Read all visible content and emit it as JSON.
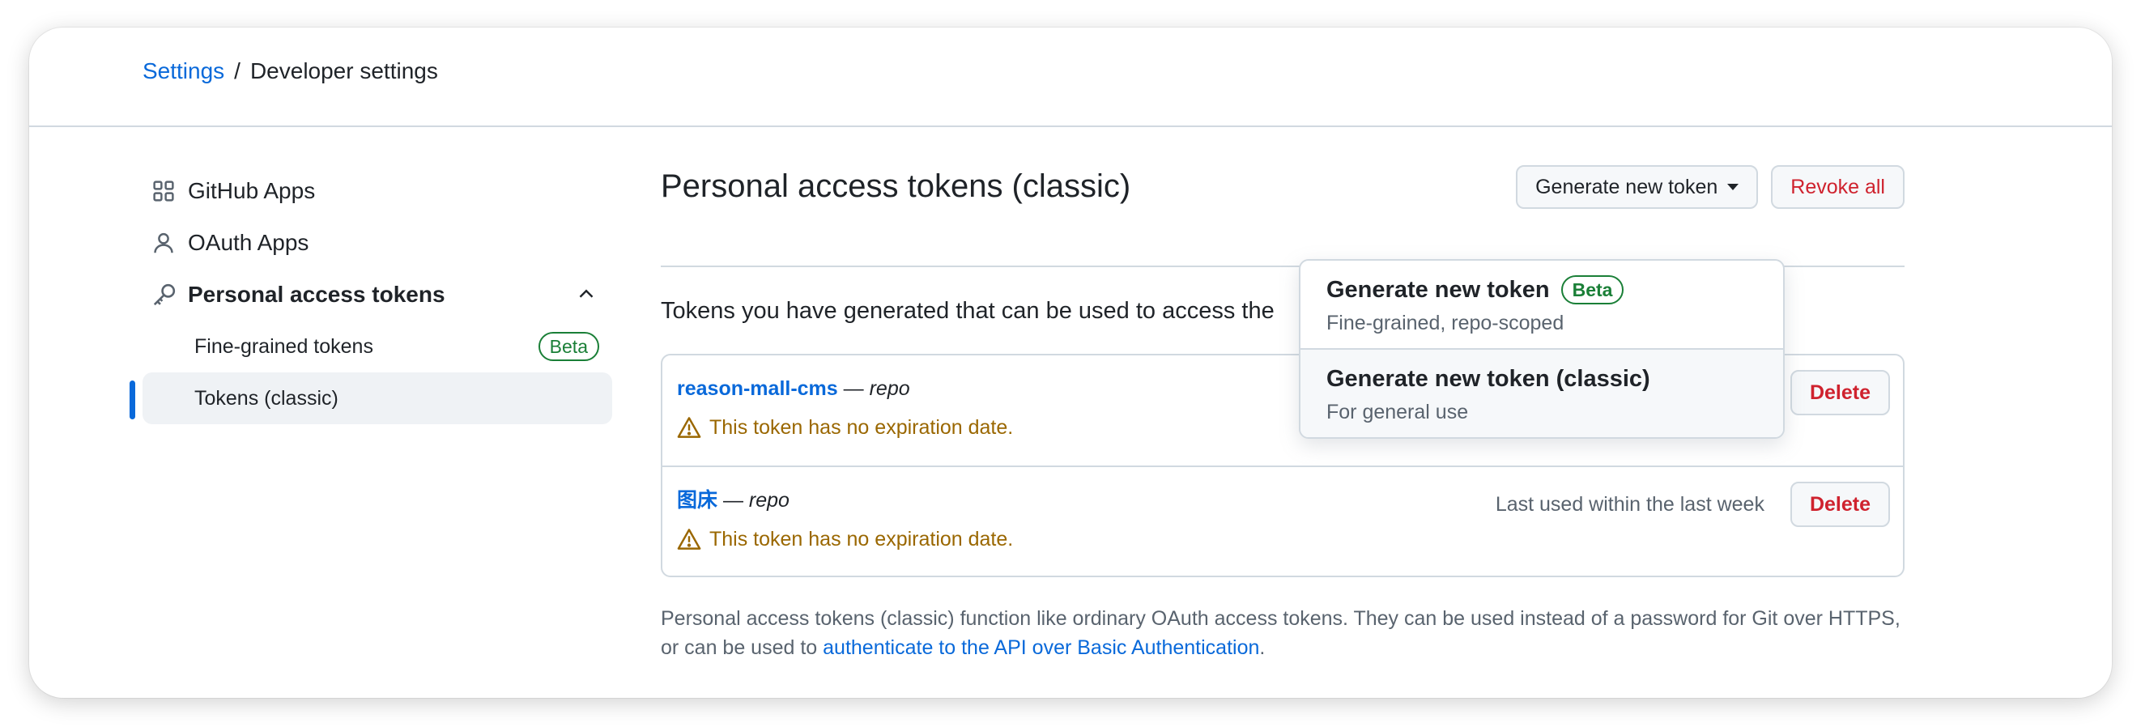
{
  "breadcrumb": {
    "root": "Settings",
    "separator": "/",
    "current": "Developer settings"
  },
  "sidebar": {
    "items": [
      {
        "label": "GitHub Apps",
        "icon": "apps-grid-icon"
      },
      {
        "label": "OAuth Apps",
        "icon": "person-icon"
      },
      {
        "label": "Personal access tokens",
        "icon": "key-icon"
      }
    ],
    "subitems": [
      {
        "label": "Fine-grained tokens",
        "badge": "Beta"
      },
      {
        "label": "Tokens (classic)"
      }
    ]
  },
  "main": {
    "title": "Personal access tokens (classic)",
    "generate_label": "Generate new token",
    "revoke_label": "Revoke all",
    "description": "Tokens you have generated that can be used to access the",
    "tokens": [
      {
        "name": "reason-mall-cms",
        "dash": "—",
        "scope": "repo",
        "warning": "This token has no expiration date.",
        "last_used": "",
        "delete_label": "Delete"
      },
      {
        "name": "图床",
        "dash": "—",
        "scope": "repo",
        "warning": "This token has no expiration date.",
        "last_used": "Last used within the last week",
        "delete_label": "Delete"
      }
    ],
    "footnote_text": "Personal access tokens (classic) function like ordinary OAuth access tokens. They can be used instead of a password for Git over HTTPS, or can be used to ",
    "footnote_link": "authenticate to the API over Basic Authentication",
    "footnote_end": "."
  },
  "menu": {
    "items": [
      {
        "title": "Generate new token",
        "badge": "Beta",
        "subtitle": "Fine-grained, repo-scoped"
      },
      {
        "title": "Generate new token (classic)",
        "subtitle": "For general use"
      }
    ]
  },
  "colors": {
    "link": "#0969da",
    "danger": "#cf222e",
    "success": "#1a7f37",
    "attention": "#9a6700",
    "border": "#d1d9e0"
  }
}
